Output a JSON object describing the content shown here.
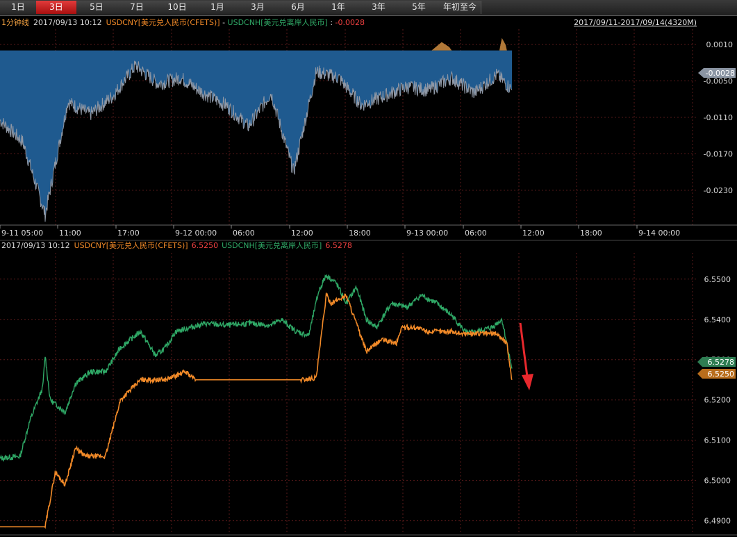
{
  "toolbar": {
    "tabs": [
      {
        "label": "1日"
      },
      {
        "label": "3日"
      },
      {
        "label": "5日"
      },
      {
        "label": "7日"
      },
      {
        "label": "10日"
      },
      {
        "label": "1月"
      },
      {
        "label": "3月"
      },
      {
        "label": "6月"
      },
      {
        "label": "1年"
      },
      {
        "label": "3年"
      },
      {
        "label": "5年"
      },
      {
        "label": "年初至今"
      }
    ],
    "active_index": 1
  },
  "colors": {
    "cny": "#f28a28",
    "cnh": "#2fa866",
    "spread_fill": "#1f5a8f",
    "spread_line": "#8f98a6",
    "spread_pos_fill": "#b07838",
    "arrow": "#e8282d",
    "grid": "#5a1a1a",
    "axis_text": "#d8d8d8"
  },
  "top_chart": {
    "header_prefix": "1分钟线",
    "header_time": "2017/09/13 10:12",
    "header_series1": "USDCNY[美元兑人民币(CFETS)]",
    "header_minus": " - ",
    "header_series2": "USDCNH[美元兑离岸人民币]",
    "header_sep": " : ",
    "header_value": "-0.0028",
    "range_label": "2017/09/11-2017/09/14(4320M)",
    "current_tag": "-0.0028"
  },
  "bottom_chart": {
    "header_time": "2017/09/13 10:12",
    "series1_label": "USDCNY[美元兑人民币(CFETS)]",
    "series1_value": "6.5250",
    "series2_label": "USDCNH[美元兑离岸人民币]",
    "series2_value": "6.5278",
    "tag_cnh": "6.5278",
    "tag_cny": "6.5250"
  },
  "chart_data": [
    {
      "type": "area",
      "series": [
        {
          "name": "USDCNY - USDCNH",
          "x": [
            0,
            90,
            180,
            270,
            360,
            450,
            540,
            630,
            720,
            810,
            900,
            990,
            1080,
            1170,
            1260,
            1350,
            1440,
            1530,
            1620,
            1710,
            1800,
            1890,
            1980,
            2040
          ],
          "values": [
            -0.0115,
            -0.015,
            -0.027,
            -0.0085,
            -0.0105,
            -0.0075,
            -0.0025,
            -0.0055,
            -0.0045,
            -0.007,
            -0.009,
            -0.0125,
            -0.007,
            -0.02,
            -0.0035,
            -0.0045,
            -0.009,
            -0.0075,
            -0.006,
            -0.0065,
            -0.0045,
            -0.007,
            -0.004,
            -0.0065
          ]
        }
      ],
      "x_ticks": [
        "9-11 05:00",
        "11:00",
        "17:00",
        "9-12 00:00",
        "06:00",
        "12:00",
        "18:00",
        "9-13 00:00",
        "06:00",
        "12:00",
        "18:00",
        "9-14 00:00"
      ],
      "y_ticks": [
        "0.0010",
        "-0.0050",
        "-0.0110",
        "-0.0170",
        "-0.0230"
      ],
      "ylim": [
        -0.0285,
        0.0035
      ]
    },
    {
      "type": "line",
      "series": [
        {
          "name": "USDCNY[美元兑人民币(CFETS)]",
          "x": [
            0,
            180,
            220,
            260,
            300,
            340,
            420,
            480,
            560,
            660,
            740,
            780,
            1200,
            1260,
            1300,
            1320,
            1380,
            1460,
            1520,
            1580,
            1600,
            1660,
            1700,
            1800,
            1840,
            1880,
            1900,
            1980,
            2020,
            2040
          ],
          "values": [
            6.4885,
            6.4885,
            6.502,
            6.499,
            6.508,
            6.506,
            6.506,
            6.52,
            6.525,
            6.525,
            6.527,
            6.525,
            6.525,
            6.5255,
            6.546,
            6.544,
            6.546,
            6.532,
            6.535,
            6.534,
            6.538,
            6.538,
            6.537,
            6.537,
            6.5365,
            6.5365,
            6.5365,
            6.5365,
            6.534,
            6.525
          ]
        },
        {
          "name": "USDCNH[美元兑离岸人民币]",
          "x": [
            0,
            80,
            120,
            170,
            180,
            200,
            260,
            300,
            360,
            420,
            480,
            560,
            620,
            660,
            700,
            760,
            820,
            900,
            1000,
            1080,
            1120,
            1180,
            1230,
            1270,
            1300,
            1340,
            1380,
            1420,
            1460,
            1500,
            1560,
            1620,
            1680,
            1740,
            1800,
            1860,
            1900,
            1960,
            2000,
            2040
          ],
          "values": [
            6.5055,
            6.506,
            6.515,
            6.523,
            6.531,
            6.52,
            6.517,
            6.524,
            6.527,
            6.527,
            6.533,
            6.537,
            6.531,
            6.533,
            6.537,
            6.538,
            6.539,
            6.5385,
            6.539,
            6.5385,
            6.54,
            6.537,
            6.536,
            6.547,
            6.551,
            6.549,
            6.544,
            6.548,
            6.54,
            6.538,
            6.544,
            6.543,
            6.546,
            6.544,
            6.541,
            6.5365,
            6.537,
            6.538,
            6.54,
            6.5278
          ]
        }
      ],
      "x_ticks": [],
      "y_ticks": [
        "6.5500",
        "6.5400",
        "6.5300",
        "6.5200",
        "6.5100",
        "6.5000",
        "6.4900"
      ],
      "ylim": [
        6.487,
        6.556
      ]
    }
  ]
}
